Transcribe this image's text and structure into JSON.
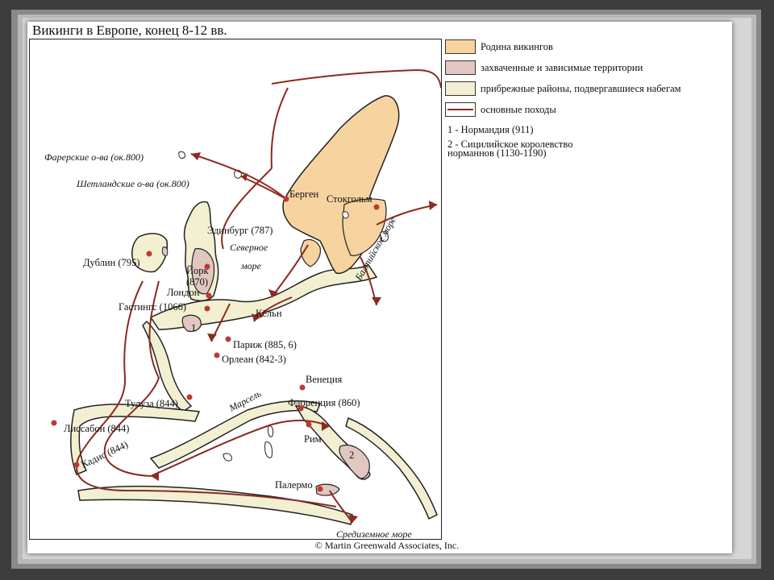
{
  "title": "Викинги в Европе, конец 8-12 вв.",
  "legend": {
    "items": [
      {
        "label": "Родина викингов",
        "color": "#f7d3a0"
      },
      {
        "label": "захваченные и зависимые территории",
        "color": "#e2c6c2"
      },
      {
        "label": "прибрежные районы, подвергавшиеся набегам",
        "color": "#f3f0d2"
      },
      {
        "label": "основные походы",
        "color": "#8b2a22"
      }
    ],
    "note1": "1 - Нормандия (911)",
    "note2_line1": "2 - Сицилийское королевство",
    "note2_line2": "норманнов (1130-1190)"
  },
  "places": {
    "faroe": "Фарерские о-ва (ок.800)",
    "shetland": "Шетландские о-ва (ок.800)",
    "bergen": "Берген",
    "stockholm": "Стокгольм",
    "edinburgh": "Эдинбург (787)",
    "dublin": "Дублин (795)",
    "york": "Йорк",
    "york_year": "(870)",
    "london": "Лондон",
    "hastings": "Гастингс (1066)",
    "cologne": "Кёльн",
    "paris": "Париж (885, 6)",
    "orleans": "Орлеан (842-3)",
    "venice": "Венеция",
    "toulouse": "Тулуза (844)",
    "marseille": "Марсель",
    "florence": "Флоренция (860)",
    "lisbon": "Лиссабон (844)",
    "cadiz": "Кадис (844)",
    "rome": "Рим",
    "palermo": "Палермо"
  },
  "seas": {
    "north_line1": "Северное",
    "north_line2": "море",
    "baltic": "Балтийское море",
    "mediterranean": "Средиземное море"
  },
  "map_numbers": {
    "n1": "1",
    "n2": "2"
  },
  "copyright": "© Martin Greenwald Associates, Inc."
}
